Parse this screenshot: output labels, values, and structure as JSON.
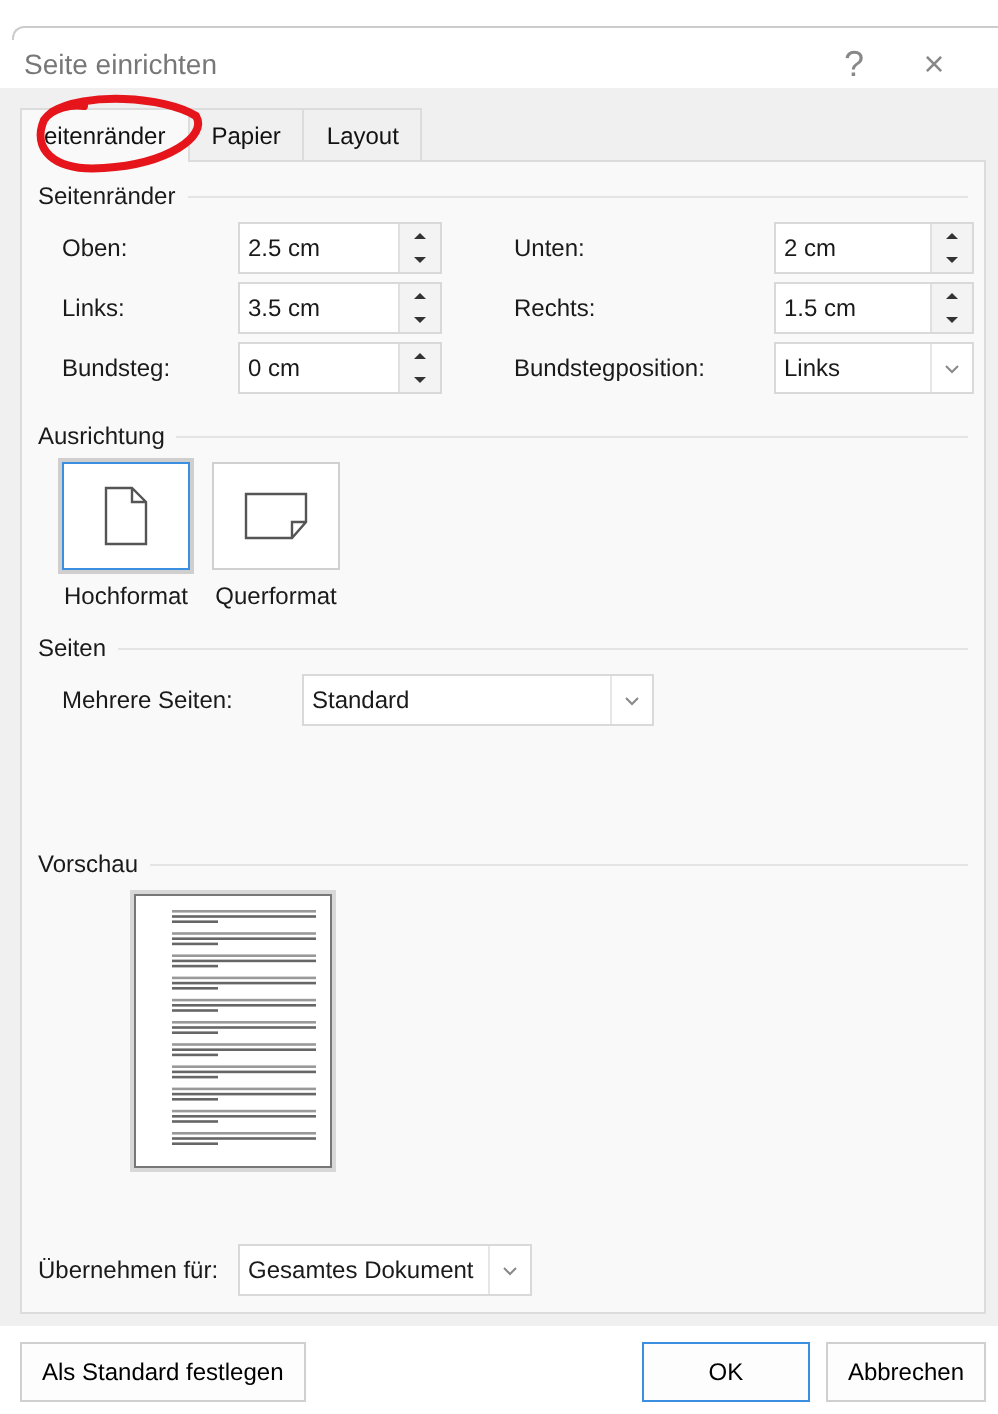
{
  "window": {
    "title": "Seite einrichten",
    "help": "?",
    "close": "×"
  },
  "tabs": [
    {
      "label": "eitenränder",
      "selected": true,
      "circled": true
    },
    {
      "label": "Papier",
      "selected": false,
      "circled": false
    },
    {
      "label": "Layout",
      "selected": false,
      "circled": false
    }
  ],
  "margins": {
    "heading": "Seitenränder",
    "fields": [
      {
        "label": "Oben:",
        "value": "2.5 cm",
        "kind": "spin"
      },
      {
        "label": "Unten:",
        "value": "2 cm",
        "kind": "spin"
      },
      {
        "label": "Links:",
        "value": "3.5 cm",
        "kind": "spin"
      },
      {
        "label": "Rechts:",
        "value": "1.5 cm",
        "kind": "spin"
      },
      {
        "label": "Bundsteg:",
        "value": "0 cm",
        "kind": "spin"
      },
      {
        "label": "Bundstegposition:",
        "value": "Links",
        "kind": "select"
      }
    ]
  },
  "orientation": {
    "heading": "Ausrichtung",
    "options": [
      {
        "label": "Hochformat",
        "kind": "portrait",
        "selected": true
      },
      {
        "label": "Querformat",
        "kind": "landscape",
        "selected": false
      }
    ]
  },
  "pages": {
    "heading": "Seiten",
    "label": "Mehrere Seiten:",
    "value": "Standard"
  },
  "preview": {
    "heading": "Vorschau"
  },
  "apply_to": {
    "label": "Übernehmen für:",
    "value": "Gesamtes Dokument"
  },
  "buttons": [
    {
      "label": "Als Standard festlegen",
      "kind": "left"
    },
    {
      "label": "OK",
      "kind": "default"
    },
    {
      "label": "Abbrechen",
      "kind": "normal"
    }
  ]
}
